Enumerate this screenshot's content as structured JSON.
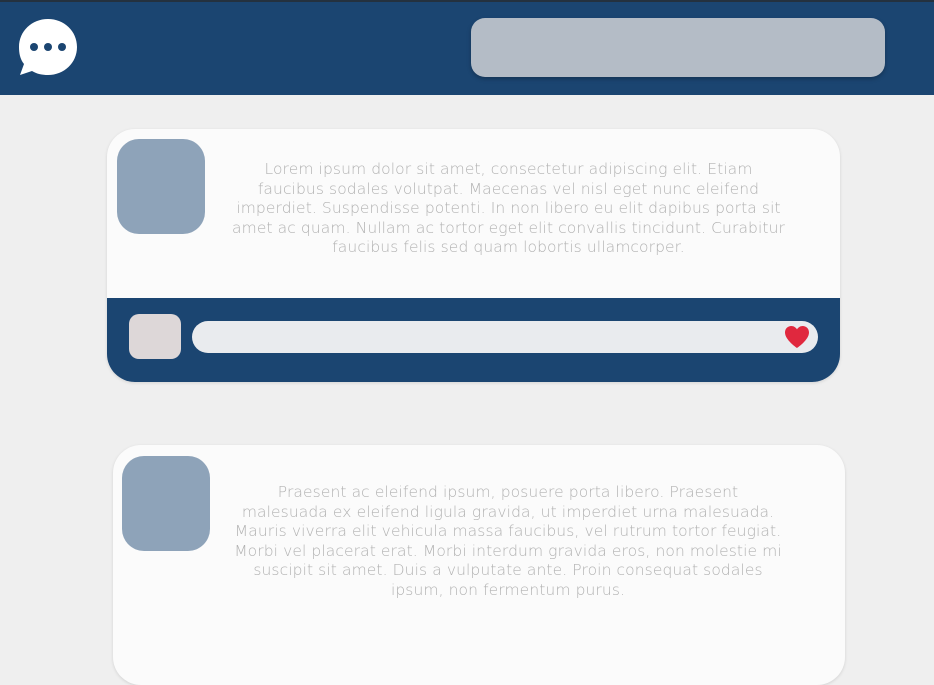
{
  "header": {
    "logo_icon": "chat-bubble-ellipsis-icon",
    "search": {
      "value": "",
      "placeholder": ""
    }
  },
  "posts": [
    {
      "text": "Lorem ipsum dolor sit amet, consectetur adipiscing elit. Etiam faucibus sodales volutpat. Maecenas vel nisl eget nunc eleifend imperdiet. Suspendisse potenti. In non libero eu elit dapibus porta sit amet ac quam. Nullam ac tortor eget elit convallis tincidunt. Curabitur faucibus felis sed quam lobortis ullamcorper.",
      "comment": {
        "value": "",
        "placeholder": "",
        "like_icon": "heart-icon"
      }
    },
    {
      "text": "Praesent ac eleifend ipsum, posuere porta libero. Praesent malesuada ex eleifend ligula gravida, ut imperdiet urna malesuada. Mauris viverra elit vehicula massa faucibus, vel rutrum tortor feugiat. Morbi vel placerat erat. Morbi interdum gravida eros, non molestie mi suscipit sit amet. Duis a vulputate ante. Proin consequat sodales ipsum, non fermentum purus."
    }
  ],
  "colors": {
    "header_bg": "#1b4571",
    "page_bg": "#efefef",
    "card_bg": "#fbfbfb",
    "avatar": "#8ea3b9",
    "search_bg": "#b4bcc6",
    "heart": "#e0283e"
  }
}
